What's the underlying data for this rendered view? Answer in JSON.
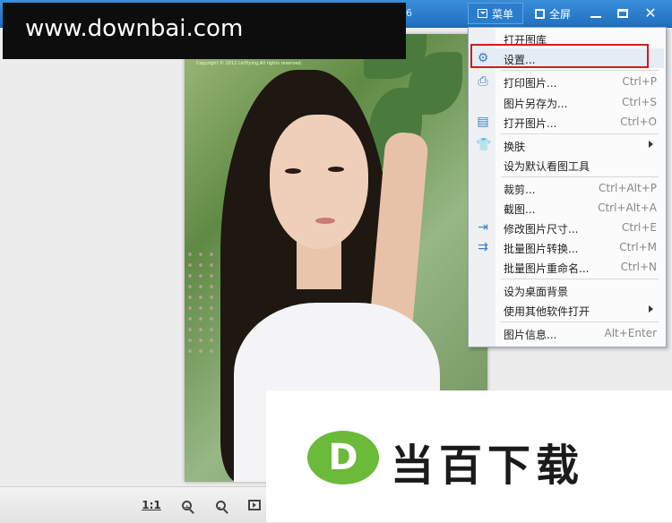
{
  "titlebar": {
    "fragment": "6",
    "menu_label": "菜单",
    "fullscreen_label": "全屏",
    "close_label": "✕"
  },
  "watermark": "www.downbai.com",
  "photo": {
    "copyright": "Copyright © 2012 LinYiying,All rights reserved."
  },
  "bottombar": {
    "ratio_label": "1:1"
  },
  "menu": {
    "items": [
      {
        "label": "打开图库",
        "shortcut": "",
        "icon": "",
        "arrow": false
      },
      {
        "label": "设置...",
        "shortcut": "",
        "icon": "gear-icon",
        "arrow": false
      },
      {
        "label": "打印图片...",
        "shortcut": "Ctrl+P",
        "icon": "printer-icon",
        "arrow": false
      },
      {
        "label": "图片另存为...",
        "shortcut": "Ctrl+S",
        "icon": "",
        "arrow": false
      },
      {
        "label": "打开图片...",
        "shortcut": "Ctrl+O",
        "icon": "folder-open-icon",
        "arrow": false
      },
      {
        "label": "换肤",
        "shortcut": "",
        "icon": "tshirt-icon",
        "arrow": true
      },
      {
        "label": "设为默认看图工具",
        "shortcut": "",
        "icon": "",
        "arrow": false
      },
      {
        "label": "裁剪...",
        "shortcut": "Ctrl+Alt+P",
        "icon": "",
        "arrow": false
      },
      {
        "label": "截图...",
        "shortcut": "Ctrl+Alt+A",
        "icon": "",
        "arrow": false
      },
      {
        "label": "修改图片尺寸...",
        "shortcut": "Ctrl+E",
        "icon": "resize-icon",
        "arrow": false
      },
      {
        "label": "批量图片转换...",
        "shortcut": "Ctrl+M",
        "icon": "batch-convert-icon",
        "arrow": false
      },
      {
        "label": "批量图片重命名...",
        "shortcut": "Ctrl+N",
        "icon": "",
        "arrow": false
      },
      {
        "label": "设为桌面背景",
        "shortcut": "",
        "icon": "",
        "arrow": false
      },
      {
        "label": "使用其他软件打开",
        "shortcut": "",
        "icon": "",
        "arrow": true
      },
      {
        "label": "图片信息...",
        "shortcut": "Alt+Enter",
        "icon": "",
        "arrow": false
      }
    ]
  },
  "brand": {
    "logo_letter": "D",
    "name": "当百下载"
  }
}
